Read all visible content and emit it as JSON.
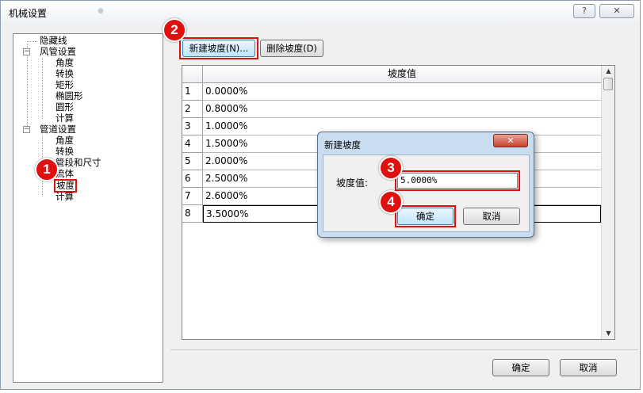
{
  "window": {
    "title": "机械设置",
    "help_label": "?",
    "close_label": "✕"
  },
  "tree": {
    "items": [
      {
        "label": "隐藏线"
      },
      {
        "label": "风管设置",
        "expander": "−"
      },
      {
        "label": "角度"
      },
      {
        "label": "转换"
      },
      {
        "label": "矩形"
      },
      {
        "label": "椭圆形"
      },
      {
        "label": "圆形"
      },
      {
        "label": "计算"
      },
      {
        "label": "管道设置",
        "expander": "−"
      },
      {
        "label": "角度"
      },
      {
        "label": "转换"
      },
      {
        "label": "管段和尺寸"
      },
      {
        "label": "流体"
      },
      {
        "label": "坡度",
        "selected": true
      },
      {
        "label": "计算"
      }
    ]
  },
  "toolbar": {
    "new_slope_label": "新建坡度(N)...",
    "delete_slope_label": "删除坡度(D)"
  },
  "grid": {
    "column_header": "坡度值",
    "rows": [
      {
        "num": "1",
        "value": "0.0000%"
      },
      {
        "num": "2",
        "value": "0.8000%"
      },
      {
        "num": "3",
        "value": "1.0000%"
      },
      {
        "num": "4",
        "value": "1.5000%"
      },
      {
        "num": "5",
        "value": "2.0000%"
      },
      {
        "num": "6",
        "value": "2.5000%"
      },
      {
        "num": "7",
        "value": "2.6000%"
      },
      {
        "num": "8",
        "value": "3.5000%"
      }
    ]
  },
  "footer": {
    "ok_label": "确定",
    "cancel_label": "取消"
  },
  "dialog": {
    "title": "新建坡度",
    "close_label": "✕",
    "field_label": "坡度值:",
    "field_value": "5.0000%",
    "ok_label": "确定",
    "cancel_label": "取消"
  },
  "callouts": {
    "step1": "1",
    "step2": "2",
    "step3": "3",
    "step4": "4"
  },
  "colors": {
    "highlight_red": "#e01010",
    "dialog_frame": "#c9dcf0"
  }
}
